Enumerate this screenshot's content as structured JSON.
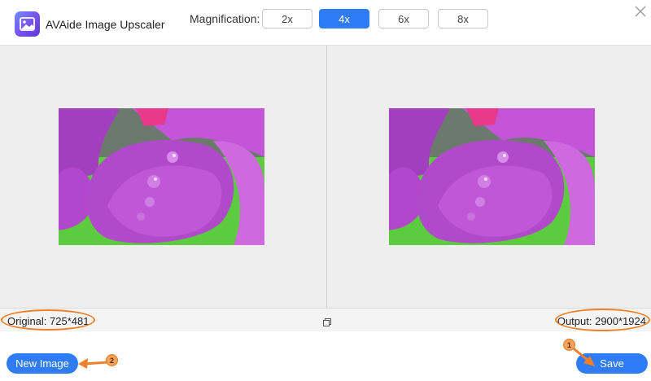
{
  "app": {
    "title": "AVAide Image Upscaler"
  },
  "magnification": {
    "label": "Magnification:",
    "options": [
      "2x",
      "4x",
      "6x",
      "8x"
    ],
    "selected": "4x"
  },
  "info": {
    "original": "Original: 725*481",
    "output": "Output: 2900*1924"
  },
  "actions": {
    "new_image": "New Image",
    "save": "Save"
  },
  "annotations": {
    "step1": "1",
    "step2": "2"
  },
  "colors": {
    "accent": "#2f7cf6",
    "annotation": "#f0812a"
  }
}
